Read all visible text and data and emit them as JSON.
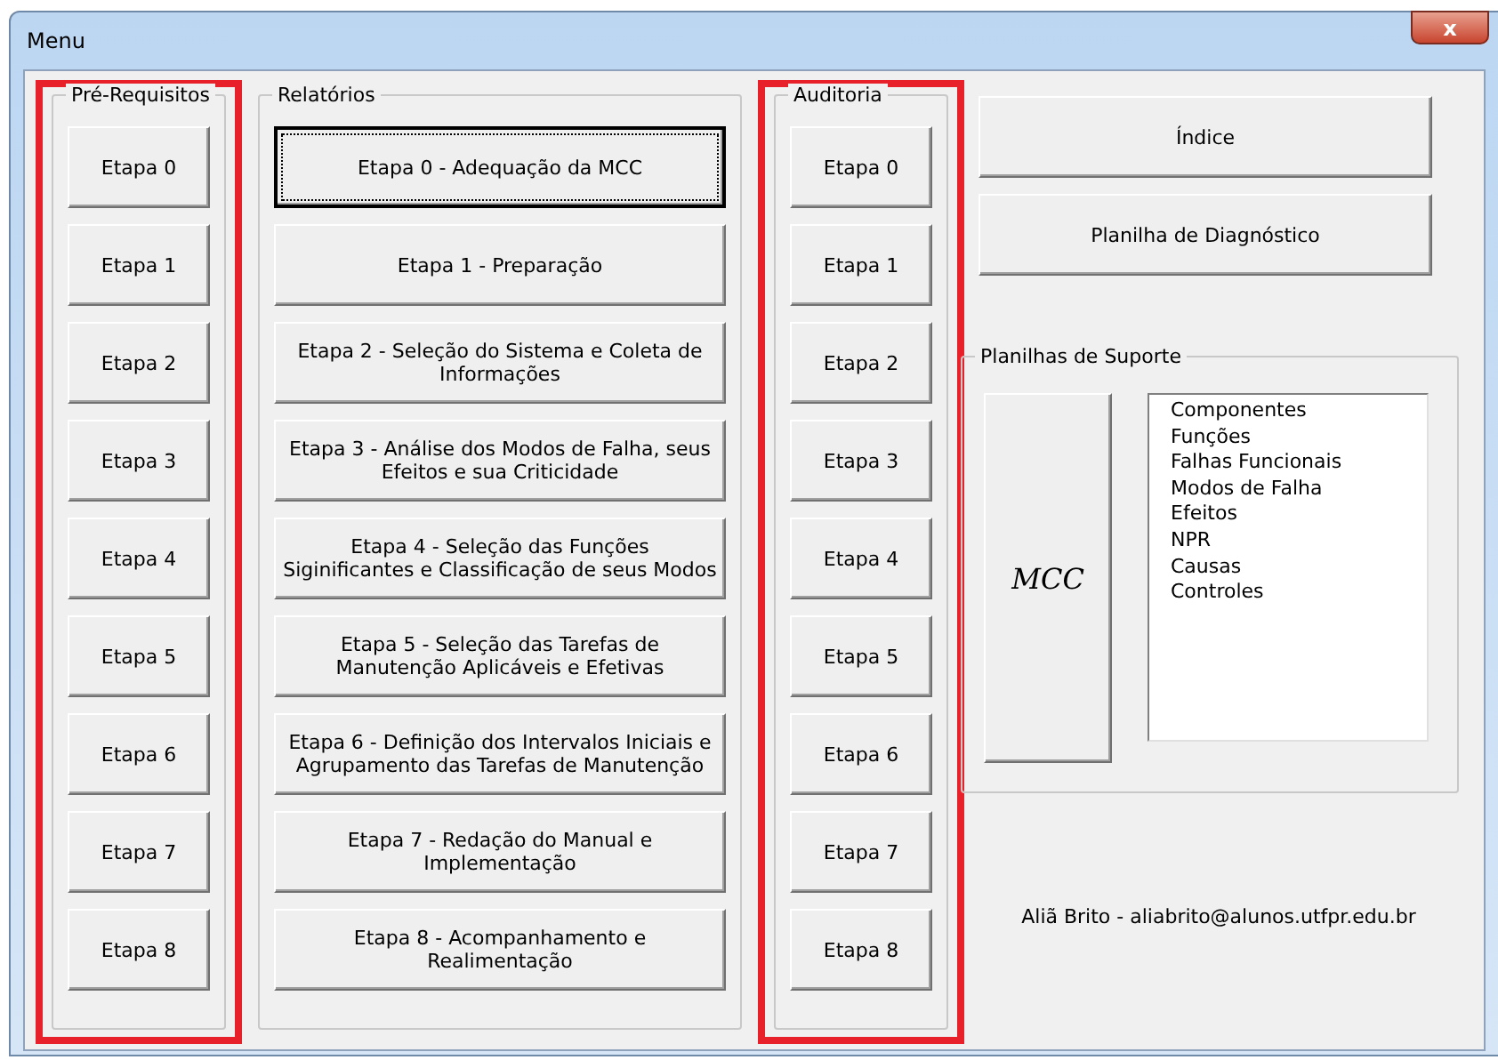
{
  "window": {
    "title": "Menu",
    "close_label": "x"
  },
  "groups": [
    {
      "title": "Pré-Requisitos",
      "highlighted": true,
      "buttons": [
        {
          "label": "Etapa 0",
          "focused": false
        },
        {
          "label": "Etapa 1",
          "focused": false
        },
        {
          "label": "Etapa 2",
          "focused": false
        },
        {
          "label": "Etapa 3",
          "focused": false
        },
        {
          "label": "Etapa 4",
          "focused": false
        },
        {
          "label": "Etapa 5",
          "focused": false
        },
        {
          "label": "Etapa 6",
          "focused": false
        },
        {
          "label": "Etapa 7",
          "focused": false
        },
        {
          "label": "Etapa 8",
          "focused": false
        }
      ]
    },
    {
      "title": "Relatórios",
      "highlighted": false,
      "buttons": [
        {
          "label": "Etapa 0 - Adequação da MCC",
          "focused": true
        },
        {
          "label": "Etapa 1 - Preparação",
          "focused": false
        },
        {
          "label": "Etapa 2 - Seleção do Sistema e Coleta de Informações",
          "focused": false
        },
        {
          "label": "Etapa 3 - Análise dos Modos de Falha, seus Efeitos e sua Criticidade",
          "focused": false
        },
        {
          "label": "Etapa 4 - Seleção das Funções Siginificantes e Classificação de seus Modos",
          "focused": false
        },
        {
          "label": "Etapa 5 - Seleção das Tarefas de Manutenção Aplicáveis e Efetivas",
          "focused": false
        },
        {
          "label": "Etapa 6 - Definição dos Intervalos Iniciais e Agrupamento das Tarefas de Manutenção",
          "focused": false
        },
        {
          "label": "Etapa 7 - Redação do Manual e Implementação",
          "focused": false
        },
        {
          "label": "Etapa 8 - Acompanhamento e Realimentação",
          "focused": false
        }
      ]
    },
    {
      "title": "Auditoria",
      "highlighted": true,
      "buttons": [
        {
          "label": "Etapa 0",
          "focused": false
        },
        {
          "label": "Etapa 1",
          "focused": false
        },
        {
          "label": "Etapa 2",
          "focused": false
        },
        {
          "label": "Etapa 3",
          "focused": false
        },
        {
          "label": "Etapa 4",
          "focused": false
        },
        {
          "label": "Etapa 5",
          "focused": false
        },
        {
          "label": "Etapa 6",
          "focused": false
        },
        {
          "label": "Etapa 7",
          "focused": false
        },
        {
          "label": "Etapa 8",
          "focused": false
        }
      ]
    }
  ],
  "side_buttons": [
    "Índice",
    "Planilha de Diagnóstico"
  ],
  "support": {
    "title": "Planilhas de Suporte",
    "button": "MCC",
    "list_items": [
      "Componentes",
      "Funções",
      "Falhas Funcionais",
      "Modos de Falha",
      "Efeitos",
      "NPR",
      "Causas",
      "Controles"
    ]
  },
  "footer": "Aliã Brito - aliabrito@alunos.utfpr.edu.br"
}
